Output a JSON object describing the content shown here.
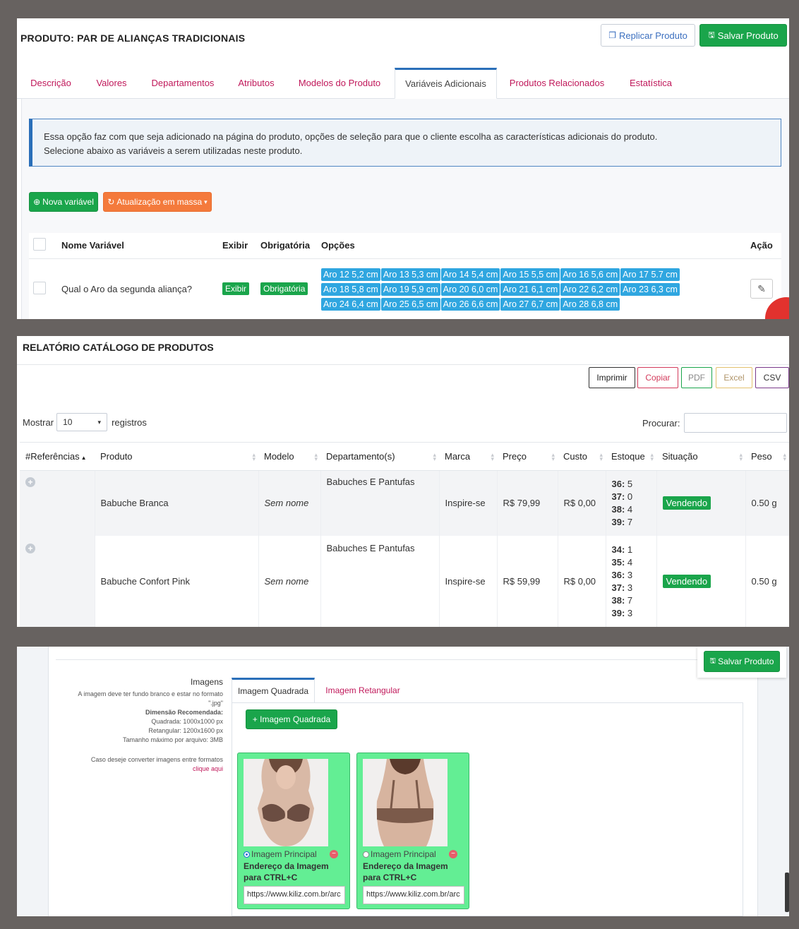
{
  "panel1": {
    "title": "PRODUTO: PAR DE ALIANÇAS TRADICIONAIS",
    "replicate_label": "Replicar Produto",
    "save_label": "Salvar Produto",
    "tabs": [
      "Descrição",
      "Valores",
      "Departamentos",
      "Atributos",
      "Modelos do Produto",
      "Variáveis Adicionais",
      "Produtos Relacionados",
      "Estatística"
    ],
    "active_tab": "Variáveis Adicionais",
    "info_line1": "Essa opção faz com que seja adicionado na página do produto, opções de seleção para que o cliente escolha as características adicionais do produto.",
    "info_line2": "Selecione abaixo as variáveis a serem utilizadas neste produto.",
    "new_variable_label": "Nova variável",
    "bulk_update_label": "Atualização em massa",
    "table": {
      "headers": [
        "Nome Variável",
        "Exibir",
        "Obrigatória",
        "Opções",
        "Ação"
      ],
      "rows": [
        {
          "name": "Qual o Aro da segunda aliança?",
          "exibir": "Exibir",
          "obrigatoria": "Obrigatória",
          "options": [
            "Aro 12 5,2 cm",
            "Aro 13 5,3 cm",
            "Aro 14 5,4 cm",
            "Aro 15 5,5 cm",
            "Aro 16 5,6 cm",
            "Aro 17 5.7 cm",
            "Aro 18 5,8 cm",
            "Aro 19 5,9 cm",
            "Aro 20 6,0 cm",
            "Aro 21 6,1 cm",
            "Aro 22 6,2 cm",
            "Aro 23 6,3 cm",
            "Aro 24 6,4 cm",
            "Aro 25 6,5 cm",
            "Aro 26 6,6 cm",
            "Aro 27 6,7 cm",
            "Aro 28 6,8 cm"
          ]
        }
      ]
    },
    "colors": {
      "accent_green": "#1aa54b",
      "accent_blue": "#2a6fb9",
      "tab_pink": "#c0185a",
      "option_blue": "#2fa6e0",
      "orange": "#f47a3c"
    }
  },
  "panel2": {
    "title": "RELATÓRIO CATÁLOGO DE PRODUTOS",
    "export_buttons": [
      "Imprimir",
      "Copiar",
      "PDF",
      "Excel",
      "CSV"
    ],
    "show_label": "Mostrar",
    "page_size": "10",
    "records_label": "registros",
    "search_label": "Procurar:",
    "headers": [
      "#Referências",
      "Produto",
      "Modelo",
      "Departamento(s)",
      "Marca",
      "Preço",
      "Custo",
      "Estoque",
      "Situação",
      "Peso"
    ],
    "rows": [
      {
        "produto": "Babuche Branca",
        "modelo": "Sem nome",
        "departamento": "Babuches E Pantufas",
        "marca": "Inspire-se",
        "preco": "R$ 79,99",
        "custo": "R$ 0,00",
        "estoque": [
          {
            "size": "36:",
            "qty": "5"
          },
          {
            "size": "37:",
            "qty": "0"
          },
          {
            "size": "38:",
            "qty": "4"
          },
          {
            "size": "39:",
            "qty": "7"
          }
        ],
        "situacao": "Vendendo",
        "peso": "0.50 g"
      },
      {
        "produto": "Babuche Confort Pink",
        "modelo": "Sem nome",
        "departamento": "Babuches E Pantufas",
        "marca": "Inspire-se",
        "preco": "R$ 59,99",
        "custo": "R$ 0,00",
        "estoque": [
          {
            "size": "34:",
            "qty": "1"
          },
          {
            "size": "35:",
            "qty": "4"
          },
          {
            "size": "36:",
            "qty": "3"
          },
          {
            "size": "37:",
            "qty": "3"
          },
          {
            "size": "38:",
            "qty": "7"
          },
          {
            "size": "39:",
            "qty": "3"
          }
        ],
        "situacao": "Vendendo",
        "peso": "0.50 g"
      }
    ]
  },
  "panel3": {
    "save_label": "Salvar Produto",
    "section_label": "Imagens",
    "help_line1": "A imagem deve ter fundo branco e estar no formato \".jpg\"",
    "help_dim_label": "Dimensão Recomendada:",
    "help_square": "Quadrada: 1000x1000 px",
    "help_rect": "Retangular: 1200x1600 px",
    "help_max": "Tamanho máximo por arquivo: 3MB",
    "help_convert": "Caso deseje converter imagens entre formatos",
    "help_link": "clique aqui",
    "tabs": [
      "Imagem Quadrada",
      "Imagem Retangular"
    ],
    "add_button": "+ Imagem Quadrada",
    "images": [
      {
        "label": "Imagem Principal",
        "address_label": "Endereço da Imagem para CTRL+C",
        "url": "https://www.kiliz.com.br/arc",
        "selected": true
      },
      {
        "label": "Imagem Principal",
        "address_label": "Endereço da Imagem para CTRL+C",
        "url": "https://www.kiliz.com.br/arc",
        "selected": false
      }
    ]
  }
}
